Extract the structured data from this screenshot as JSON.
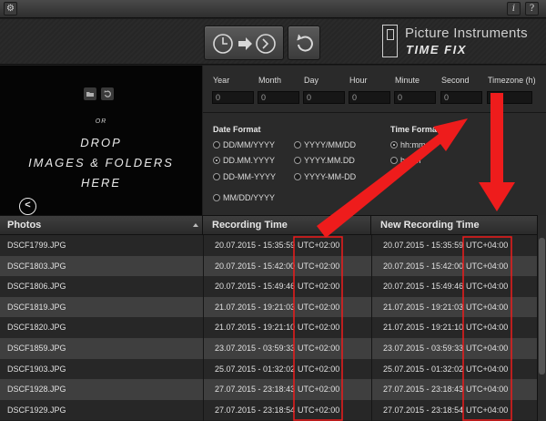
{
  "toolbar": {
    "gear_icon": "gear-icon",
    "info_label": "i",
    "help_label": "?"
  },
  "header": {
    "convert_icons": [
      "clock-icon",
      "arrow-right-icon",
      "clock-forward-icon"
    ],
    "reset_icon": "reset-icon",
    "brand_name": "Picture Instruments",
    "product_name": "TIME FIX"
  },
  "drop": {
    "icons": [
      "folder-icon",
      "refresh-icon"
    ],
    "or_text": "OR",
    "text": "DROP\nIMAGES & FOLDERS\nHERE",
    "back_icon": "chevron-left-icon",
    "back_glyph": "<"
  },
  "fields": [
    {
      "label": "Year",
      "value": "0"
    },
    {
      "label": "Month",
      "value": "0"
    },
    {
      "label": "Day",
      "value": "0"
    },
    {
      "label": "Hour",
      "value": "0"
    },
    {
      "label": "Minute",
      "value": "0"
    },
    {
      "label": "Second",
      "value": "0"
    },
    {
      "label": "Timezone (h)",
      "value": "2"
    }
  ],
  "date_format": {
    "title": "Date Format",
    "options": [
      {
        "label": "DD/MM/YYYY",
        "selected": false
      },
      {
        "label": "DD.MM.YYYY",
        "selected": true
      },
      {
        "label": "DD-MM-YYYY",
        "selected": false
      },
      {
        "label": "MM/DD/YYYY",
        "selected": false
      },
      {
        "label": "YYYY/MM/DD",
        "selected": false
      },
      {
        "label": "YYYY.MM.DD",
        "selected": false
      },
      {
        "label": "YYYY-MM-DD",
        "selected": false
      }
    ]
  },
  "time_format": {
    "title": "Time Format",
    "options": [
      {
        "label": "hh:mm",
        "selected": true
      },
      {
        "label": "h:mm",
        "selected": false
      }
    ]
  },
  "table": {
    "headers": [
      "Photos",
      "Recording Time",
      "New Recording Time"
    ],
    "rows": [
      {
        "file": "DSCF1799.JPG",
        "rec": "20.07.2015 - 15:35:59",
        "rec_tz": "UTC+02:00",
        "new": "20.07.2015 - 15:35:59",
        "new_tz": "UTC+04:00"
      },
      {
        "file": "DSCF1803.JPG",
        "rec": "20.07.2015 - 15:42:00",
        "rec_tz": "UTC+02:00",
        "new": "20.07.2015 - 15:42:00",
        "new_tz": "UTC+04:00"
      },
      {
        "file": "DSCF1806.JPG",
        "rec": "20.07.2015 - 15:49:46",
        "rec_tz": "UTC+02:00",
        "new": "20.07.2015 - 15:49:46",
        "new_tz": "UTC+04:00"
      },
      {
        "file": "DSCF1819.JPG",
        "rec": "21.07.2015 - 19:21:03",
        "rec_tz": "UTC+02:00",
        "new": "21.07.2015 - 19:21:03",
        "new_tz": "UTC+04:00"
      },
      {
        "file": "DSCF1820.JPG",
        "rec": "21.07.2015 - 19:21:10",
        "rec_tz": "UTC+02:00",
        "new": "21.07.2015 - 19:21:10",
        "new_tz": "UTC+04:00"
      },
      {
        "file": "DSCF1859.JPG",
        "rec": "23.07.2015 - 03:59:33",
        "rec_tz": "UTC+02:00",
        "new": "23.07.2015 - 03:59:33",
        "new_tz": "UTC+04:00"
      },
      {
        "file": "DSCF1903.JPG",
        "rec": "25.07.2015 - 01:32:02",
        "rec_tz": "UTC+02:00",
        "new": "25.07.2015 - 01:32:02",
        "new_tz": "UTC+04:00"
      },
      {
        "file": "DSCF1928.JPG",
        "rec": "27.07.2015 - 23:18:43",
        "rec_tz": "UTC+02:00",
        "new": "27.07.2015 - 23:18:43",
        "new_tz": "UTC+04:00"
      },
      {
        "file": "DSCF1929.JPG",
        "rec": "27.07.2015 - 23:18:54",
        "rec_tz": "UTC+02:00",
        "new": "27.07.2015 - 23:18:54",
        "new_tz": "UTC+04:00"
      }
    ]
  },
  "colors": {
    "annotation_red": "#ee1c1c",
    "row_dark": "#272727",
    "row_light": "#3f3f3f"
  }
}
